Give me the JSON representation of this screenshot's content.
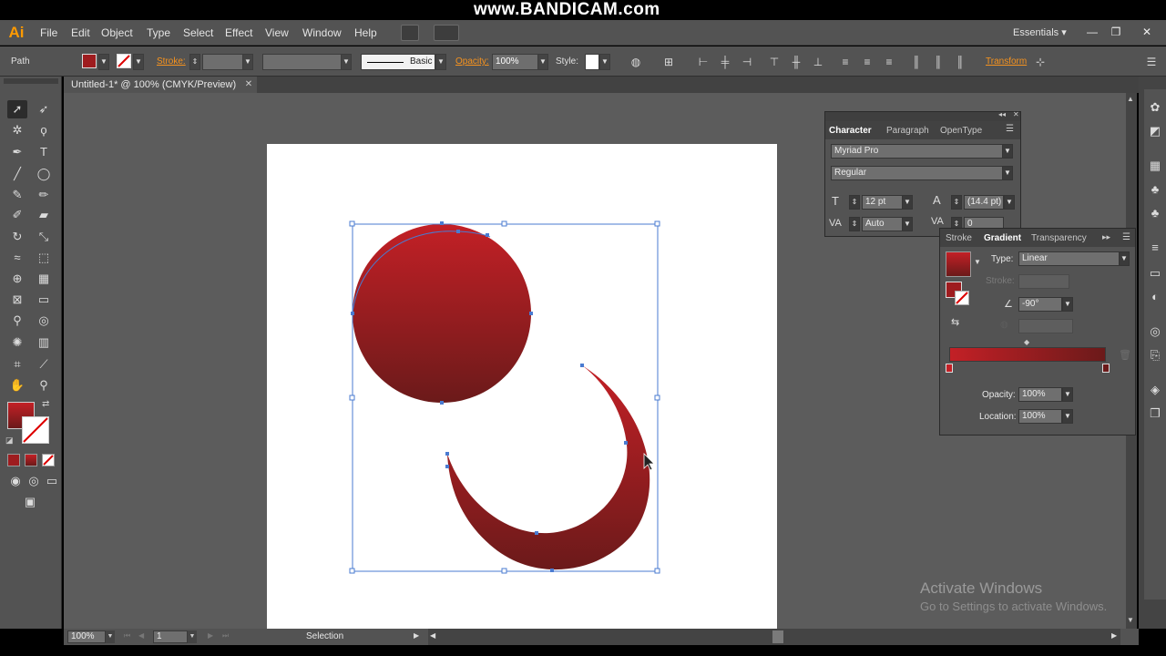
{
  "app": {
    "logo": "Ai",
    "overlay_watermark": "www.BANDICAM.com",
    "workspace": "Essentials ▾"
  },
  "menu": [
    "File",
    "Edit",
    "Object",
    "Type",
    "Select",
    "Effect",
    "View",
    "Window",
    "Help"
  ],
  "window_controls": {
    "minimize": "—",
    "restore": "❐",
    "close": "✕"
  },
  "control_bar": {
    "selection_type": "Path",
    "stroke_label": "Stroke:",
    "brush_label": "Basic",
    "opacity_label": "Opacity:",
    "opacity_value": "100%",
    "style_label": "Style:",
    "transform_label": "Transform"
  },
  "document_tab": {
    "title": "Untitled-1* @ 100% (CMYK/Preview)",
    "close": "✕"
  },
  "character_panel": {
    "tabs": [
      "Character",
      "Paragraph",
      "OpenType"
    ],
    "font_family": "Myriad Pro",
    "font_style": "Regular",
    "font_size": "12 pt",
    "leading": "(14.4 pt)",
    "kerning": "Auto",
    "tracking": "0"
  },
  "gradient_panel": {
    "tabs": [
      "Stroke",
      "Gradient",
      "Transparency"
    ],
    "type_label": "Type:",
    "type_value": "Linear",
    "stroke_label": "Stroke:",
    "angle_value": "-90°",
    "opacity_label": "Opacity:",
    "opacity_value": "100%",
    "location_label": "Location:",
    "location_value": "100%",
    "gradient_start": "#c32026",
    "gradient_end": "#6b1a1a"
  },
  "status_bar": {
    "zoom": "100%",
    "artboard_number": "1",
    "tool_status": "Selection"
  },
  "watermark": {
    "title": "Activate Windows",
    "subtitle": "Go to Settings to activate Windows."
  },
  "colors": {
    "fill_swatch": "#9e1c1f",
    "accent": "#f7931e",
    "selection_box": "#4a7bd1"
  },
  "icons": {
    "tools": [
      "selection-arrow",
      "direct-selection",
      "magic-wand",
      "lasso",
      "pen",
      "type",
      "line",
      "ellipse",
      "paintbrush",
      "pencil",
      "blob-brush",
      "eraser",
      "rotate",
      "scale",
      "width",
      "free-transform",
      "shape-builder",
      "perspective-grid",
      "mesh",
      "gradient",
      "eyedropper",
      "blend",
      "symbol-sprayer",
      "column-graph",
      "artboard",
      "slice",
      "hand",
      "zoom"
    ],
    "dock": [
      "color-guide",
      "swatches",
      "brushes",
      "symbols",
      "graphic-styles",
      "appearance",
      "layers",
      "artboards",
      "align",
      "pathfinder",
      "transparency",
      "stroke",
      "gradient"
    ]
  }
}
